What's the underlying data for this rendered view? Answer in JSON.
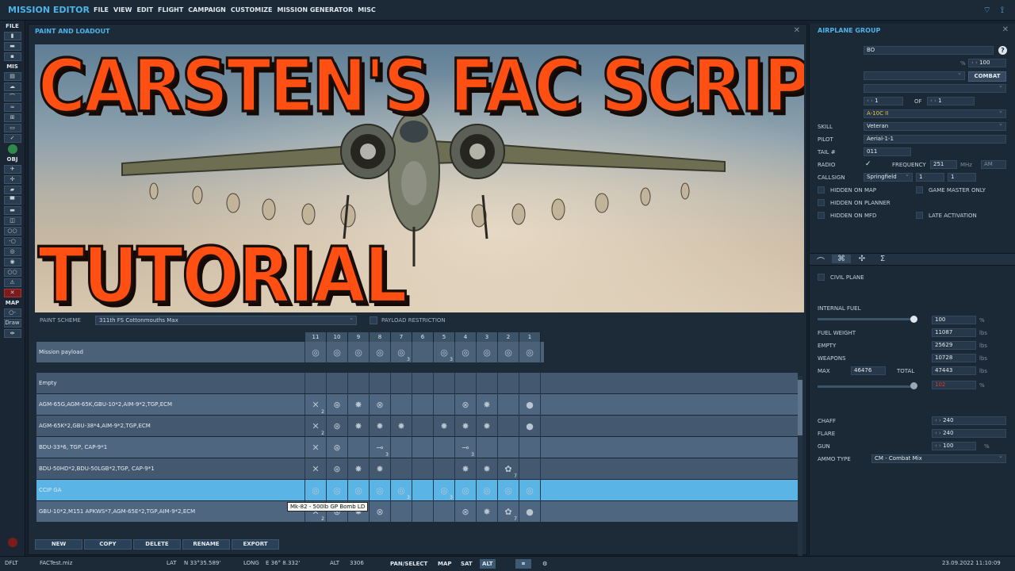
{
  "app": {
    "title": "MISSION EDITOR"
  },
  "menu": [
    "FILE",
    "VIEW",
    "EDIT",
    "FLIGHT",
    "CAMPAIGN",
    "CUSTOMIZE",
    "MISSION GENERATOR",
    "MISC"
  ],
  "left_toolbar": {
    "file": "FILE",
    "mis": "MIS",
    "obj": "OBJ",
    "map": "MAP",
    "draw": "Draw"
  },
  "paint_panel": {
    "title": "PAINT AND LOADOUT",
    "thumbnail_line1": "CARSTEN'S FAC SCRIPT",
    "thumbnail_line2": "TUTORIAL",
    "paint_scheme_label": "PAINT SCHEME",
    "paint_scheme_value": "311th FS Cottonmouths Max",
    "payload_restriction_label": "PAYLOAD RESTRICTION",
    "stations": [
      "11",
      "10",
      "9",
      "8",
      "7",
      "6",
      "5",
      "4",
      "3",
      "2",
      "1"
    ],
    "mission_payload_label": "Mission payload",
    "rows": [
      {
        "name": "Empty"
      },
      {
        "name": "AGM-65G,AGM-65K,GBU-10*2,AIM-9*2,TGP,ECM"
      },
      {
        "name": "AGM-65K*2,GBU-38*4,AIM-9*2,TGP,ECM"
      },
      {
        "name": "BDU-33*6, TGP, CAP-9*1"
      },
      {
        "name": "BDU-50HD*2,BDU-50LGB*2,TGP, CAP-9*1"
      },
      {
        "name": "CCIP GA"
      },
      {
        "name": "GBU-10*2,M151 APKWS*7,AGM-65E*2,TGP,AIM-9*2,ECM"
      }
    ],
    "tooltip": "Mk-82 - 500lb GP Bomb LD",
    "buttons": [
      "NEW",
      "COPY",
      "DELETE",
      "RENAME",
      "EXPORT"
    ]
  },
  "airplane_group": {
    "title": "AIRPLANE GROUP",
    "name_value": "BO",
    "percent_value": "100",
    "combat_button": "COMBAT",
    "of_label": "OF",
    "count_value": "1",
    "of_value": "1",
    "type_value": "A-10C II",
    "skill_label": "SKILL",
    "skill_value": "Veteran",
    "pilot_label": "PILOT",
    "pilot_value": "Aerial-1-1",
    "tail_label": "TAIL #",
    "tail_value": "011",
    "radio_label": "RADIO",
    "frequency_label": "FREQUENCY",
    "frequency_value": "251",
    "mhz_label": "MHz",
    "am_label": "AM",
    "callsign_label": "CALLSIGN",
    "callsign_value": "Springfield",
    "callsign_n1": "1",
    "callsign_n2": "1",
    "hidden_on_map": "HIDDEN ON MAP",
    "game_master_only": "GAME MASTER ONLY",
    "hidden_on_planner": "HIDDEN ON PLANNER",
    "hidden_on_mfd": "HIDDEN ON MFD",
    "late_activation": "LATE ACTIVATION",
    "civil_plane": "CIVIL PLANE",
    "internal_fuel_label": "INTERNAL FUEL",
    "internal_fuel_value": "100",
    "fuel_weight_label": "FUEL WEIGHT",
    "fuel_weight_value": "11087",
    "empty_label": "EMPTY",
    "empty_value": "25629",
    "weapons_label": "WEAPONS",
    "weapons_value": "10728",
    "max_label": "MAX",
    "max_value": "46476",
    "total_label": "TOTAL",
    "total_value": "47443",
    "overload_value": "102",
    "chaff_label": "CHAFF",
    "chaff_value": "240",
    "flare_label": "FLARE",
    "flare_value": "240",
    "gun_label": "GUN",
    "gun_value": "100",
    "ammo_type_label": "AMMO TYPE",
    "ammo_type_value": "CM - Combat Mix",
    "units": {
      "percent": "%",
      "lbs": "lbs"
    }
  },
  "status_bar": {
    "mode": "DFLT",
    "file": "FACTest.miz",
    "lat_label": "LAT",
    "lat_value": "N 33°35.589'",
    "long_label": "LONG",
    "long_value": "E 36° 8.332'",
    "alt_label": "ALT",
    "alt_value": "3306",
    "pan_select": "PAN/SELECT",
    "map": "MAP",
    "sat": "SAT",
    "alt_btn": "ALT",
    "datetime": "23.09.2022 11:10:09"
  },
  "colors": {
    "accent": "#4fb3e8",
    "thumbnail_text": "#ff4f12",
    "selected_row": "#5ab4e6"
  }
}
